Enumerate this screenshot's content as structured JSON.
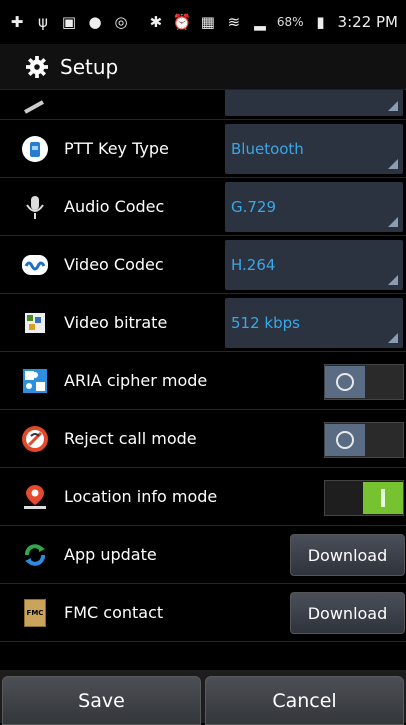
{
  "statusbar": {
    "battery_pct": "68%",
    "time": "3:22 PM",
    "icons_left": [
      "plus-icon",
      "usb-icon",
      "image-icon",
      "avatar-icon",
      "wifi-signal-icon"
    ],
    "icons_right": [
      "bluetooth-icon",
      "alarm-icon",
      "hd-icon",
      "wifi-icon",
      "signal-icon",
      "battery-icon"
    ]
  },
  "header": {
    "title": "Setup"
  },
  "rows": {
    "ptt": {
      "label": "PTT Key Type",
      "value": "Bluetooth"
    },
    "audio": {
      "label": "Audio Codec",
      "value": "G.729"
    },
    "video": {
      "label": "Video Codec",
      "value": "H.264"
    },
    "bitrate": {
      "label": "Video bitrate",
      "value": "512 kbps"
    },
    "aria": {
      "label": "ARIA cipher mode",
      "state": "off"
    },
    "reject": {
      "label": "Reject call mode",
      "state": "off"
    },
    "location": {
      "label": "Location info mode",
      "state": "on"
    },
    "update": {
      "label": "App update",
      "button": "Download"
    },
    "fmc": {
      "label": "FMC contact",
      "button": "Download",
      "icon_text": "FMC"
    }
  },
  "bottom": {
    "save": "Save",
    "cancel": "Cancel"
  },
  "colors": {
    "select_bg": "#2b3240",
    "select_text": "#3aa7e6",
    "toggle_on": "#76c230"
  }
}
